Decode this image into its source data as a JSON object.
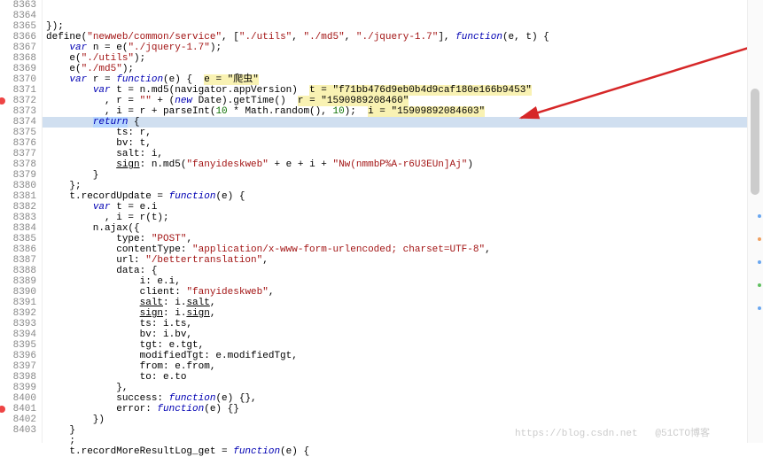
{
  "lines": [
    {
      "num": 8363,
      "bp": false,
      "hi": false,
      "html": "});"
    },
    {
      "num": 8364,
      "bp": false,
      "hi": false,
      "html": "define(<span class=\"str\">\"newweb/common/service\"</span>, [<span class=\"str\">\"./utils\"</span>, <span class=\"str\">\"./md5\"</span>, <span class=\"str\">\"./jquery-1.7\"</span>], <span class=\"kw\">function</span>(e, t) {"
    },
    {
      "num": 8365,
      "bp": false,
      "hi": false,
      "html": "    <span class=\"kw\">var</span> n = e(<span class=\"str\">\"./jquery-1.7\"</span>);"
    },
    {
      "num": 8366,
      "bp": false,
      "hi": false,
      "html": "    e(<span class=\"str\">\"./utils\"</span>);"
    },
    {
      "num": 8367,
      "bp": false,
      "hi": false,
      "html": "    e(<span class=\"str\">\"./md5\"</span>);"
    },
    {
      "num": 8368,
      "bp": false,
      "hi": false,
      "html": "    <span class=\"kw\">var</span> r = <span class=\"kw\">function</span>(e) {  <span class=\"tok\">e = \"爬虫\"</span>"
    },
    {
      "num": 8369,
      "bp": false,
      "hi": false,
      "html": "        <span class=\"kw\">var</span> t = n.md5(navigator.appVersion)  <span class=\"tok\">t = \"f71bb476d9eb0b4d9caf180e166b9453\"</span>"
    },
    {
      "num": 8370,
      "bp": false,
      "hi": false,
      "html": "          , r = <span class=\"str\">\"\"</span> + (<span class=\"kw\">new</span> Date).getTime()  <span class=\"tok\">r = \"1590989208460\"</span>"
    },
    {
      "num": 8371,
      "bp": false,
      "hi": false,
      "html": "          , i = r + parseInt(<span class=\"num\">10</span> * Math.random(), <span class=\"num\">10</span>);  <span class=\"tok\">i = \"15909892084603\"</span>"
    },
    {
      "num": 8372,
      "bp": true,
      "hi": true,
      "html": "        <span class=\"sel\"><span class=\"kw\">return</span></span> {"
    },
    {
      "num": 8373,
      "bp": false,
      "hi": false,
      "html": "            ts: r,"
    },
    {
      "num": 8374,
      "bp": false,
      "hi": false,
      "html": "            bv: t,"
    },
    {
      "num": 8375,
      "bp": false,
      "hi": false,
      "html": "            salt: i,"
    },
    {
      "num": 8376,
      "bp": false,
      "hi": false,
      "html": "            <span class=\"und\">sign</span>: n.md5(<span class=\"str\">\"fanyideskweb\"</span> + e + i + <span class=\"str\">\"Nw(nmmbP%A-r6U3EUn]Aj\"</span>)"
    },
    {
      "num": 8377,
      "bp": false,
      "hi": false,
      "html": "        }"
    },
    {
      "num": 8378,
      "bp": false,
      "hi": false,
      "html": "    };"
    },
    {
      "num": 8379,
      "bp": false,
      "hi": false,
      "html": "    t.recordUpdate = <span class=\"kw\">function</span>(e) {"
    },
    {
      "num": 8380,
      "bp": false,
      "hi": false,
      "html": "        <span class=\"kw\">var</span> t = e.i"
    },
    {
      "num": 8381,
      "bp": false,
      "hi": false,
      "html": "          , i = r(t);"
    },
    {
      "num": 8382,
      "bp": false,
      "hi": false,
      "html": "        n.ajax({"
    },
    {
      "num": 8383,
      "bp": false,
      "hi": false,
      "html": "            type: <span class=\"str\">\"POST\"</span>,"
    },
    {
      "num": 8384,
      "bp": false,
      "hi": false,
      "html": "            contentType: <span class=\"str\">\"application/x-www-form-urlencoded; charset=UTF-8\"</span>,"
    },
    {
      "num": 8385,
      "bp": false,
      "hi": false,
      "html": "            url: <span class=\"str\">\"/bettertranslation\"</span>,"
    },
    {
      "num": 8386,
      "bp": false,
      "hi": false,
      "html": "            data: {"
    },
    {
      "num": 8387,
      "bp": false,
      "hi": false,
      "html": "                i: e.i,"
    },
    {
      "num": 8388,
      "bp": false,
      "hi": false,
      "html": "                client: <span class=\"str\">\"fanyideskweb\"</span>,"
    },
    {
      "num": 8389,
      "bp": false,
      "hi": false,
      "html": "                <span class=\"und\">salt</span>: i.<span class=\"und\">salt</span>,"
    },
    {
      "num": 8390,
      "bp": false,
      "hi": false,
      "html": "                <span class=\"und\">sign</span>: i.<span class=\"und\">sign</span>,"
    },
    {
      "num": 8391,
      "bp": false,
      "hi": false,
      "html": "                ts: i.ts,"
    },
    {
      "num": 8392,
      "bp": false,
      "hi": false,
      "html": "                bv: i.bv,"
    },
    {
      "num": 8393,
      "bp": false,
      "hi": false,
      "html": "                tgt: e.tgt,"
    },
    {
      "num": 8394,
      "bp": false,
      "hi": false,
      "html": "                modifiedTgt: e.modifiedTgt,"
    },
    {
      "num": 8395,
      "bp": false,
      "hi": false,
      "html": "                from: e.from,"
    },
    {
      "num": 8396,
      "bp": false,
      "hi": false,
      "html": "                to: e.to"
    },
    {
      "num": 8397,
      "bp": false,
      "hi": false,
      "html": "            },"
    },
    {
      "num": 8398,
      "bp": false,
      "hi": false,
      "html": "            success: <span class=\"kw\">function</span>(e) {},"
    },
    {
      "num": 8399,
      "bp": false,
      "hi": false,
      "html": "            error: <span class=\"kw\">function</span>(e) {}"
    },
    {
      "num": 8400,
      "bp": false,
      "hi": false,
      "html": "        })"
    },
    {
      "num": 8401,
      "bp": true,
      "hi": false,
      "html": "    }"
    },
    {
      "num": 8402,
      "bp": false,
      "hi": false,
      "html": "    ;"
    },
    {
      "num": 8403,
      "bp": false,
      "hi": false,
      "html": "    t.recordMoreResultLog_get = <span class=\"kw\">function</span>(e) {"
    }
  ],
  "watermark_left": "https://blog.csdn.net",
  "watermark_right": "@51CTO博客",
  "arrow_color": "#d62728",
  "side_dots": [
    "#6aa7f0",
    "#f0a060",
    "#6aa7f0",
    "#60c060",
    "#6aa7f0"
  ]
}
